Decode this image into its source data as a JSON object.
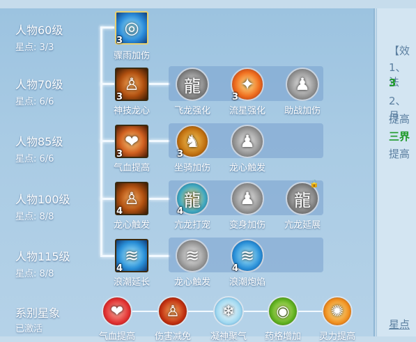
{
  "tiers": [
    {
      "level": "人物60级",
      "stars": "星点: 3/3"
    },
    {
      "level": "人物70级",
      "stars": "星点: 6/6"
    },
    {
      "level": "人物85级",
      "stars": "星点: 6/6"
    },
    {
      "level": "人物100级",
      "stars": "星点: 8/8"
    },
    {
      "level": "人物115级",
      "stars": "星点: 8/8"
    }
  ],
  "skills": {
    "r1": [
      {
        "name": "骤雨加伤",
        "count": "3",
        "icon": "swirl-icon"
      }
    ],
    "r2": [
      {
        "name": "神技龙心",
        "count": "3",
        "icon": "warrior-icon"
      },
      {
        "name": "飞龙强化",
        "count": "",
        "icon": "dragon-icon"
      },
      {
        "name": "流星强化",
        "count": "3",
        "icon": "meteor-icon"
      },
      {
        "name": "助战加伤",
        "count": "",
        "icon": "figure-icon"
      }
    ],
    "r3": [
      {
        "name": "气血提高",
        "count": "3",
        "icon": "heart-icon"
      },
      {
        "name": "坐骑加伤",
        "count": "3",
        "icon": "mount-icon"
      },
      {
        "name": "龙心触发",
        "count": "",
        "icon": "figure-icon"
      }
    ],
    "r4": [
      {
        "name": "龙心触发",
        "count": "4",
        "icon": "warrior-icon"
      },
      {
        "name": "亢龙打宠",
        "count": "4",
        "icon": "dragon-icon"
      },
      {
        "name": "变身加伤",
        "count": "",
        "icon": "figure-icon"
      },
      {
        "name": "亢龙延展",
        "count": "",
        "icon": "dragon-icon",
        "locked": true
      }
    ],
    "r5": [
      {
        "name": "浪潮延长",
        "count": "4",
        "icon": "wave-icon"
      },
      {
        "name": "龙心触发",
        "count": "",
        "icon": "wave-icon"
      },
      {
        "name": "浪潮炮焰",
        "count": "4",
        "icon": "wave-icon"
      }
    ]
  },
  "series": {
    "title": "系别星象",
    "status": "已激活",
    "items": [
      "气血提高",
      "伤害减免",
      "凝神聚气",
      "药格增加",
      "灵力提高"
    ]
  },
  "side_panel": {
    "line1": "【效",
    "line2": "1、法",
    "line3": "3",
    "line4": "2、月",
    "line5": "提高",
    "line6": "三界",
    "line7": "提高",
    "footer": "星点"
  },
  "colors": {
    "green": "#1e9a2a",
    "side_text": "#5b7fa0"
  }
}
